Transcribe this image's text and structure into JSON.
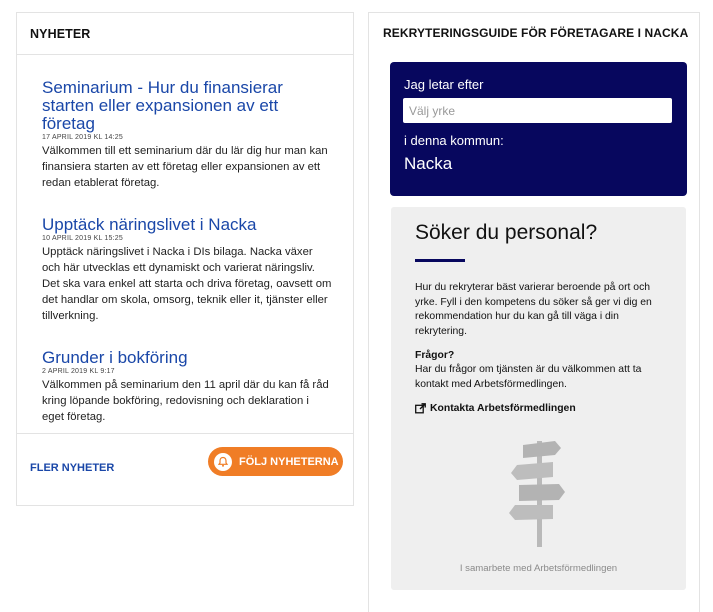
{
  "news": {
    "heading": "NYHETER",
    "items": [
      {
        "title": "Seminarium - Hur du finansierar starten eller expansionen av ett företag",
        "meta": "17 APRIL 2019   KL 14:25",
        "body": "Välkommen till ett seminarium där du lär dig hur man kan finansiera starten av ett företag eller expansionen av ett redan etablerat företag."
      },
      {
        "title": "Upptäck näringslivet i Nacka",
        "meta": "10 APRIL 2019   KL 15:25",
        "body": "Upptäck näringslivet i Nacka i DIs bilaga. Nacka växer och här utvecklas ett dynamiskt och varierat näringsliv. Det ska vara enkel att starta och driva företag, oavsett om det handlar om skola, omsorg, teknik eller it, tjänster eller tillverkning."
      },
      {
        "title": "Grunder i bokföring",
        "meta": "2 APRIL 2019   KL 9:17",
        "body": "Välkommen på seminarium den 11 april där du kan få råd kring löpande bokföring, redovisning och deklaration i eget företag."
      }
    ],
    "more_link": "FLER NYHETER",
    "follow_button": "FÖLJ NYHETERNA",
    "follow_icon": "bell-icon"
  },
  "guide": {
    "heading": "REKRYTERINGSGUIDE FÖR FÖRETAGARE I NACKA",
    "search": {
      "label_looking": "Jag letar efter",
      "placeholder": "Välj yrke",
      "label_municipality": "i denna kommun:",
      "municipality": "Nacka"
    },
    "promo": {
      "title": "Söker du personal?",
      "intro": "Hur du rekryterar bäst varierar beroende på ort och yrke. Fyll i den kompetens du söker så ger vi dig en rekommendation hur du kan gå till väga i din rekrytering.",
      "questions_heading": "Frågor?",
      "questions_text": "Har du frågor om tjänsten är du välkommen att ta kontakt med Arbetsförmedlingen.",
      "contact_link": "Kontakta Arbetsförmedlingen",
      "contact_icon": "external-link-icon",
      "image_icon": "signpost-icon",
      "partner_text": "I samarbete med Arbetsförmedlingen"
    }
  },
  "colors": {
    "link_blue": "#1a47a8",
    "navy": "#07075e",
    "orange": "#f07d26",
    "panel_gray": "#efefef"
  }
}
